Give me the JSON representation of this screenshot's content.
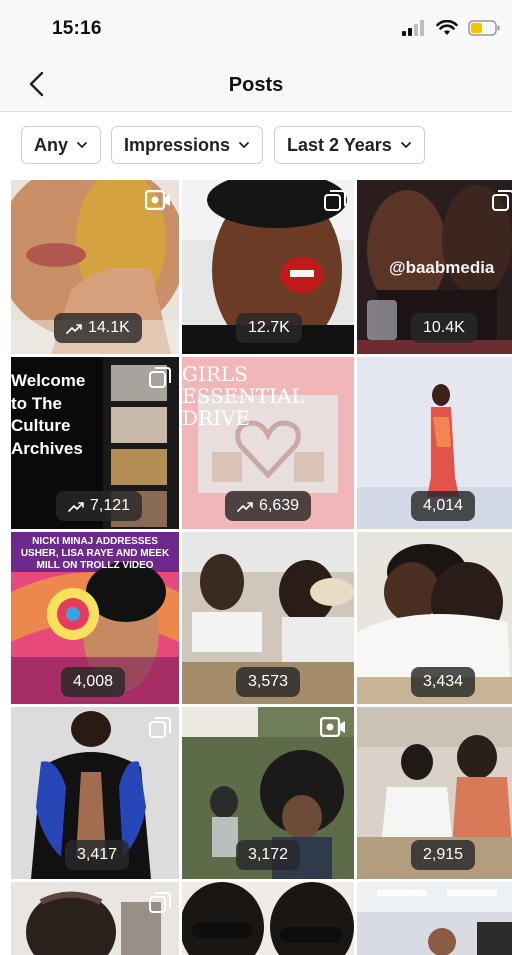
{
  "status": {
    "time": "15:16"
  },
  "nav": {
    "title": "Posts"
  },
  "filters": [
    {
      "label": "Any"
    },
    {
      "label": "Impressions"
    },
    {
      "label": "Last 2 Years"
    }
  ],
  "posts": [
    {
      "count": "14.1K",
      "trend": true,
      "type": "video"
    },
    {
      "count": "12.7K",
      "trend": false,
      "type": "multi"
    },
    {
      "count": "10.4K",
      "trend": false,
      "type": "multi",
      "overlay": "@baabmedia"
    },
    {
      "count": "7,121",
      "trend": true,
      "type": "multi",
      "overlay": "Welcome to The Culture Archives"
    },
    {
      "count": "6,639",
      "trend": true,
      "type": "none",
      "overlay": "GIRLS ESSENTIAL DRIVE"
    },
    {
      "count": "4,014",
      "trend": false,
      "type": "none"
    },
    {
      "count": "4,008",
      "trend": false,
      "type": "none",
      "overlay": "NICKI MINAJ ADDRESSES USHER, LISA RAYE AND MEEK MILL ON TROLLZ VIDEO"
    },
    {
      "count": "3,573",
      "trend": false,
      "type": "none"
    },
    {
      "count": "3,434",
      "trend": false,
      "type": "none"
    },
    {
      "count": "3,417",
      "trend": false,
      "type": "multi"
    },
    {
      "count": "3,172",
      "trend": false,
      "type": "video"
    },
    {
      "count": "2,915",
      "trend": false,
      "type": "none"
    }
  ]
}
